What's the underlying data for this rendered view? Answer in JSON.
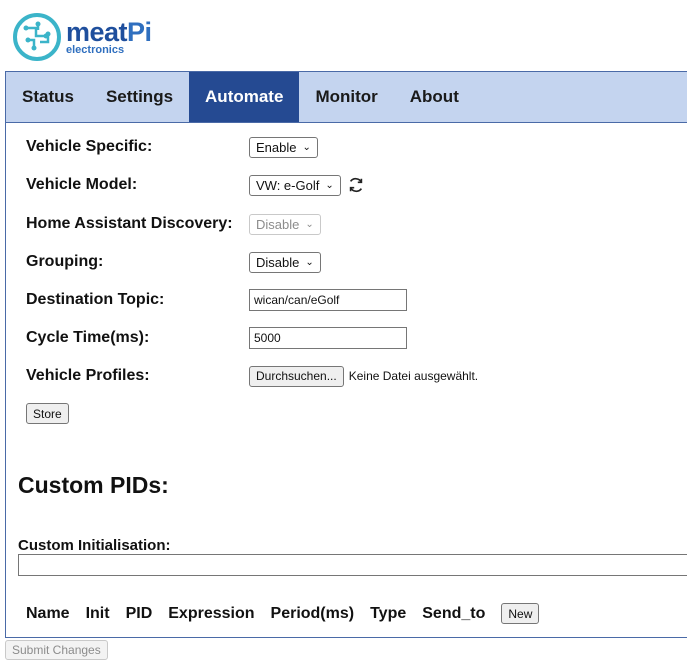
{
  "logo": {
    "brand_main": "meat",
    "brand_pi": "Pi",
    "brand_sub": "electronics"
  },
  "nav": {
    "tabs": [
      "Status",
      "Settings",
      "Automate",
      "Monitor",
      "About"
    ],
    "active": "Automate"
  },
  "form": {
    "vehicle_specific": {
      "label": "Vehicle Specific:",
      "value": "Enable"
    },
    "vehicle_model": {
      "label": "Vehicle Model:",
      "value": "VW: e-Golf"
    },
    "ha_discovery": {
      "label": "Home Assistant Discovery:",
      "value": "Disable"
    },
    "grouping": {
      "label": "Grouping:",
      "value": "Disable"
    },
    "destination_topic": {
      "label": "Destination Topic:",
      "value": "wican/can/eGolf"
    },
    "cycle_time": {
      "label": "Cycle Time(ms):",
      "value": "5000"
    },
    "vehicle_profiles": {
      "label": "Vehicle Profiles:",
      "browse_label": "Durchsuchen...",
      "status": "Keine Datei ausgewählt."
    },
    "store_label": "Store"
  },
  "custom_pids": {
    "title": "Custom PIDs:",
    "init_label": "Custom Initialisation:",
    "init_value": "",
    "columns": [
      "Name",
      "Init",
      "PID",
      "Expression",
      "Period(ms)",
      "Type",
      "Send_to"
    ],
    "new_label": "New"
  },
  "submit_label": "Submit Changes",
  "colors": {
    "nav_bg": "#c4d4ef",
    "nav_active": "#254a92",
    "border": "#4a6aa7",
    "brand": "#1f4f9d",
    "logo_circle": "#3bb4c9"
  }
}
